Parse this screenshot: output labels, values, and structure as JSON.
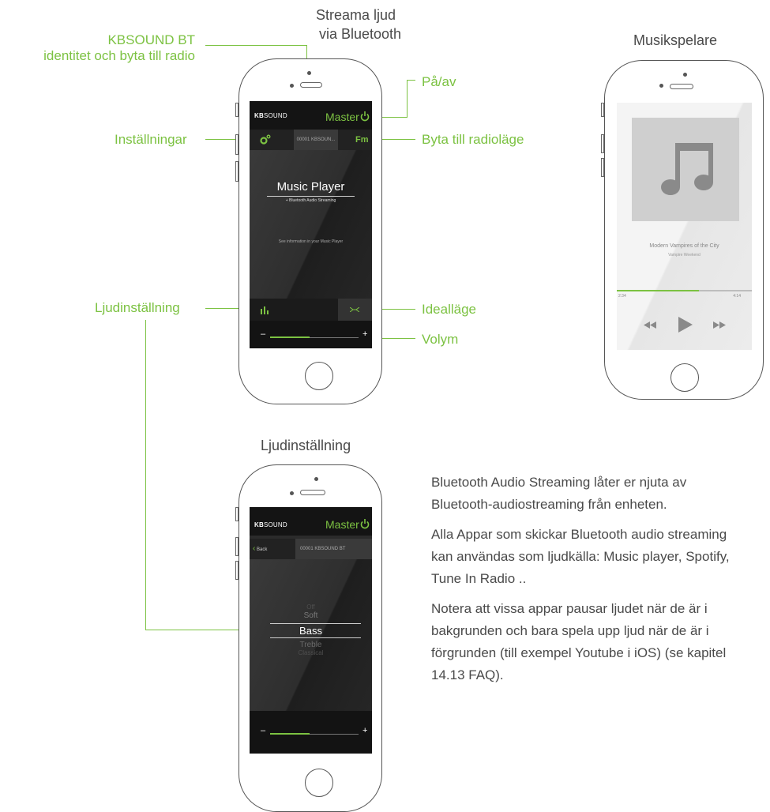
{
  "top_titles": {
    "streaming": [
      "Streama ljud",
      "via Bluetooth"
    ],
    "music_player": "Musikspelare"
  },
  "callouts": {
    "kbsound_bt": [
      "KBSOUND BT",
      "identitet och byta till radio"
    ],
    "power": "På/av",
    "settings": "Inställningar",
    "radio_mode": "Byta till radioläge",
    "sound_setting": "Ljudinställning",
    "ideal_mode": "Idealläge",
    "volume": "Volym"
  },
  "phone1": {
    "brand_bold": "KB",
    "brand_rest": "SOUND",
    "master": "Master",
    "device_tab": "00001 KBSOUN...",
    "fm_tab": "Fm",
    "title": "Music Player",
    "subtitle": "+ Bluetooth Audio Streaming",
    "info": "See information in your Music Player",
    "volume_level": 0.45
  },
  "phone2": {
    "track": "Modern Vampires of the City",
    "artist": "Vampire Weekend",
    "elapsed": "2:34",
    "total": "4:14",
    "progress": 0.61
  },
  "section_title": "Ljudinställning",
  "phone3": {
    "brand_bold": "KB",
    "brand_rest": "SOUND",
    "master": "Master",
    "back": "Back",
    "device_tab": "00001 KBSOUND BT",
    "eq_options": [
      "Off",
      "Soft",
      "Bass",
      "Treble",
      "Classical"
    ],
    "eq_selected": "Bass",
    "volume_level": 0.45
  },
  "description": [
    "Bluetooth Audio Streaming låter er njuta av Bluetooth-audiostreaming från enheten.",
    "Alla Appar som skickar Bluetooth audio streaming kan användas som ljudkälla: Music player, Spotify, Tune In Radio ..",
    "Notera att vissa appar pausar ljudet när de är i bakgrunden och bara spela upp ljud när de är i förgrunden (till exempel Youtube i iOS) (se kapitel 14.13 FAQ)."
  ],
  "colors": {
    "accent": "#7cc242",
    "text": "#4a4a4a",
    "screen": "#2b2b2b"
  }
}
